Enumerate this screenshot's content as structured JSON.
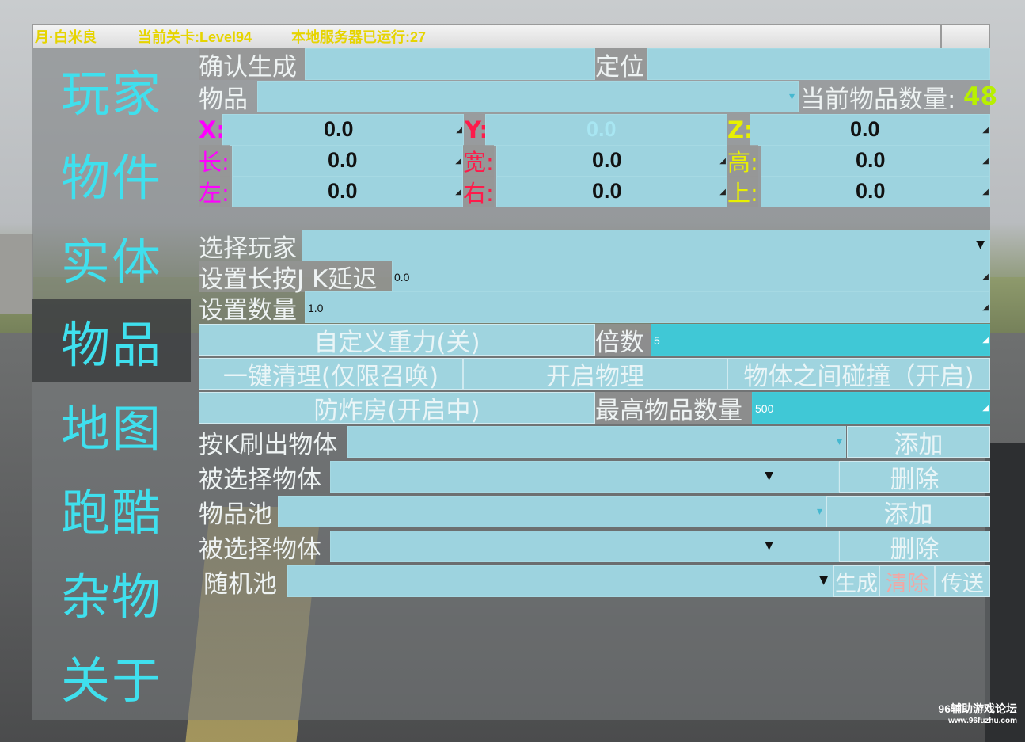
{
  "title_bar": {
    "player": "月·白米良",
    "level": "当前关卡:Level94",
    "server": "本地服务器已运行:27"
  },
  "nav": [
    "玩家",
    "物件",
    "实体",
    "物品",
    "地图",
    "跑酷",
    "杂物",
    "关于"
  ],
  "nav_active": "物品",
  "form": {
    "confirm_label": "确认生成",
    "locate_label": "定位",
    "item_label": "物品",
    "count_label": "当前物品数量:",
    "count_value": "48",
    "x_label": "X:",
    "x_value": "0.0",
    "y_label": "Y:",
    "y_value": "0.0",
    "z_label": "Z:",
    "z_value": "0.0",
    "len_label": "长:",
    "len_value": "0.0",
    "wid_label": "宽:",
    "wid_value": "0.0",
    "hei_label": "高:",
    "hei_value": "0.0",
    "left_label": "左:",
    "left_value": "0.0",
    "right_label": "右:",
    "right_value": "0.0",
    "up_label": "上:",
    "up_value": "0.0",
    "select_player_label": "选择玩家",
    "jk_delay_label": "设置长按J K延迟",
    "jk_delay_value": "0.0",
    "qty_label": "设置数量",
    "qty_value": "1.0",
    "gravity_button": "自定义重力(关)",
    "multiplier_label": "倍数",
    "multiplier_value": "5",
    "cleanup_button": "一键清理(仅限召唤)",
    "physics_button": "开启物理",
    "collision_button": "物体之间碰撞（开启)",
    "bombproof_button": "防炸房(开启中)",
    "max_items_label": "最高物品数量",
    "max_items_value": "500",
    "k_spawn_label": "按K刷出物体",
    "add_button_1": "添加",
    "selected_obj_label_1": "被选择物体",
    "delete_button_1": "删除",
    "pool_label": "物品池",
    "add_button_2": "添加",
    "selected_obj_label_2": "被选择物体",
    "delete_button_2": "删除",
    "random_pool_label": "随机池",
    "generate_button": "生成",
    "clear_button": "清除",
    "teleport_button": "传送"
  },
  "watermark": {
    "line1": "96辅助游戏论坛",
    "line2": "www.96fuzhu.com"
  },
  "colors": {
    "nav_text": "#3fe0ee",
    "title_text": "#e6d400",
    "x_label": "#ff00ff",
    "y_label": "#ff1a4a",
    "z_label": "#e8f000",
    "count_value": "#b8f000"
  }
}
